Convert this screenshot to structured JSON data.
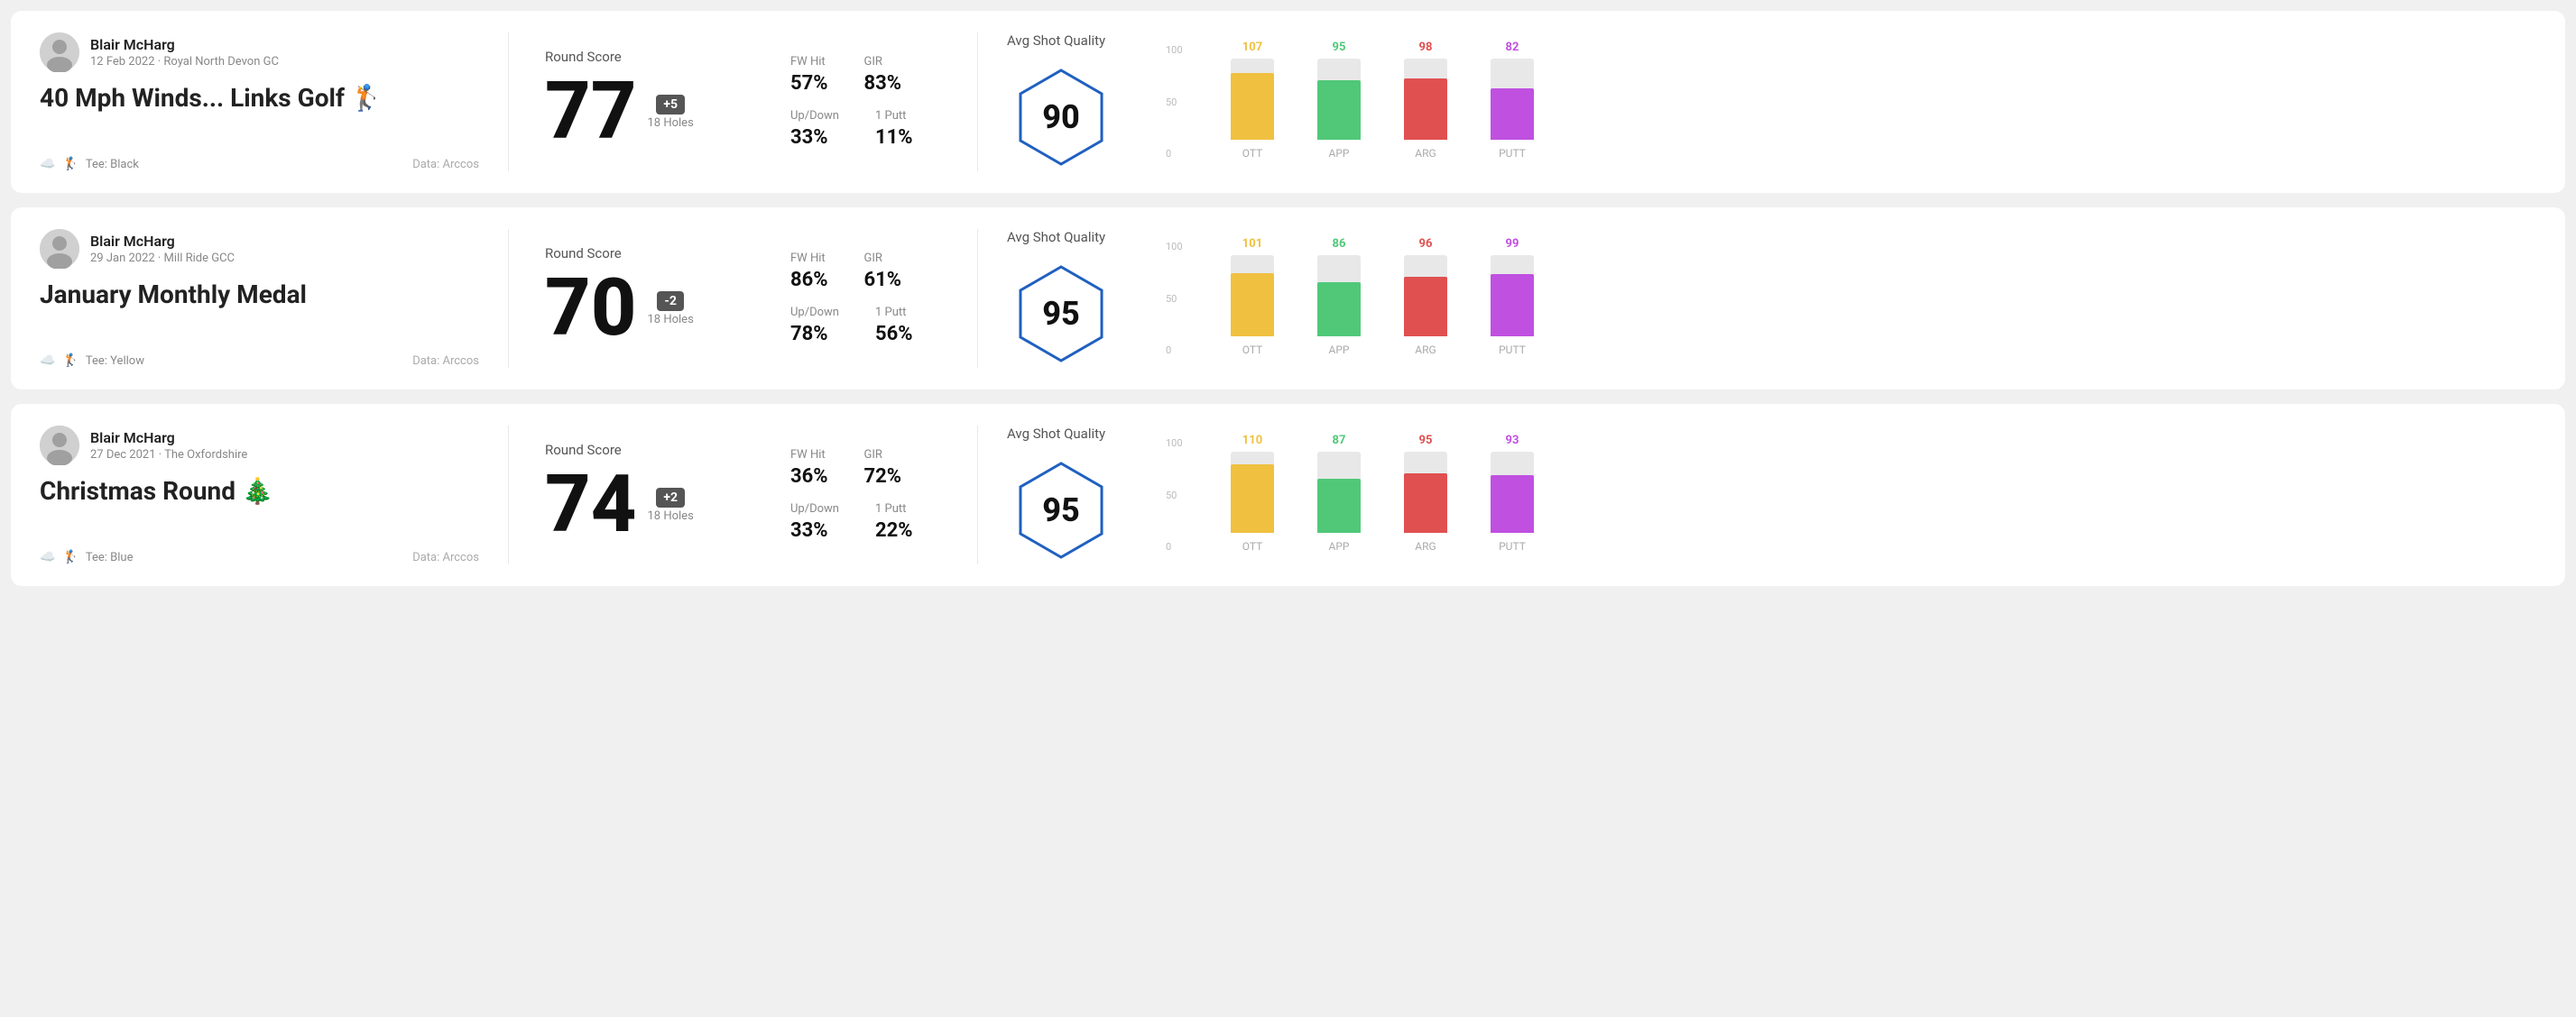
{
  "rounds": [
    {
      "id": "round-1",
      "player": "Blair McHarg",
      "date_course": "12 Feb 2022 · Royal North Devon GC",
      "title": "40 Mph Winds... Links Golf 🏌️",
      "tee": "Tee: Black",
      "data_source": "Data: Arccos",
      "round_score_label": "Round Score",
      "score": "77",
      "score_diff": "+5",
      "score_diff_type": "positive",
      "holes": "18 Holes",
      "fw_hit_label": "FW Hit",
      "fw_hit": "57%",
      "gir_label": "GIR",
      "gir": "83%",
      "updown_label": "Up/Down",
      "updown": "33%",
      "oneputt_label": "1 Putt",
      "oneputt": "11%",
      "avg_shot_quality_label": "Avg Shot Quality",
      "quality_score": "90",
      "bars": [
        {
          "label": "OTT",
          "value": 107,
          "color": "#f0c040",
          "max": 130
        },
        {
          "label": "APP",
          "value": 95,
          "color": "#50c878",
          "max": 130
        },
        {
          "label": "ARG",
          "value": 98,
          "color": "#e05050",
          "max": 130
        },
        {
          "label": "PUTT",
          "value": 82,
          "color": "#c050e0",
          "max": 130
        }
      ]
    },
    {
      "id": "round-2",
      "player": "Blair McHarg",
      "date_course": "29 Jan 2022 · Mill Ride GCC",
      "title": "January Monthly Medal",
      "tee": "Tee: Yellow",
      "data_source": "Data: Arccos",
      "round_score_label": "Round Score",
      "score": "70",
      "score_diff": "-2",
      "score_diff_type": "negative",
      "holes": "18 Holes",
      "fw_hit_label": "FW Hit",
      "fw_hit": "86%",
      "gir_label": "GIR",
      "gir": "61%",
      "updown_label": "Up/Down",
      "updown": "78%",
      "oneputt_label": "1 Putt",
      "oneputt": "56%",
      "avg_shot_quality_label": "Avg Shot Quality",
      "quality_score": "95",
      "bars": [
        {
          "label": "OTT",
          "value": 101,
          "color": "#f0c040",
          "max": 130
        },
        {
          "label": "APP",
          "value": 86,
          "color": "#50c878",
          "max": 130
        },
        {
          "label": "ARG",
          "value": 96,
          "color": "#e05050",
          "max": 130
        },
        {
          "label": "PUTT",
          "value": 99,
          "color": "#c050e0",
          "max": 130
        }
      ]
    },
    {
      "id": "round-3",
      "player": "Blair McHarg",
      "date_course": "27 Dec 2021 · The Oxfordshire",
      "title": "Christmas Round 🎄",
      "tee": "Tee: Blue",
      "data_source": "Data: Arccos",
      "round_score_label": "Round Score",
      "score": "74",
      "score_diff": "+2",
      "score_diff_type": "positive",
      "holes": "18 Holes",
      "fw_hit_label": "FW Hit",
      "fw_hit": "36%",
      "gir_label": "GIR",
      "gir": "72%",
      "updown_label": "Up/Down",
      "updown": "33%",
      "oneputt_label": "1 Putt",
      "oneputt": "22%",
      "avg_shot_quality_label": "Avg Shot Quality",
      "quality_score": "95",
      "bars": [
        {
          "label": "OTT",
          "value": 110,
          "color": "#f0c040",
          "max": 130
        },
        {
          "label": "APP",
          "value": 87,
          "color": "#50c878",
          "max": 130
        },
        {
          "label": "ARG",
          "value": 95,
          "color": "#e05050",
          "max": 130
        },
        {
          "label": "PUTT",
          "value": 93,
          "color": "#c050e0",
          "max": 130
        }
      ]
    }
  ],
  "y_axis": [
    "100",
    "50",
    "0"
  ]
}
